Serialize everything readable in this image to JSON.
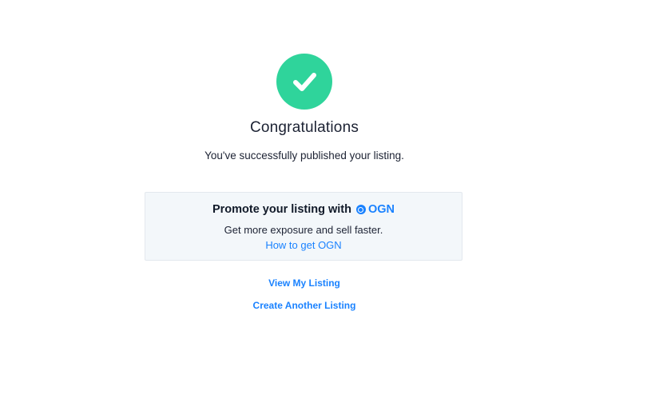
{
  "success": {
    "icon": "checkmark-icon",
    "title": "Congratulations",
    "message": "You've successfully published your listing."
  },
  "promo": {
    "title": "Promote your listing with",
    "token_name": "OGN",
    "token_icon": "ogn-token-icon",
    "description": "Get more exposure and sell faster.",
    "link_label": "How to get OGN"
  },
  "actions": {
    "view_listing": "View My Listing",
    "create_listing": "Create Another Listing"
  },
  "colors": {
    "success": "#2fd49b",
    "link": "#1a82ff",
    "promo_bg": "#f3f7fa"
  }
}
